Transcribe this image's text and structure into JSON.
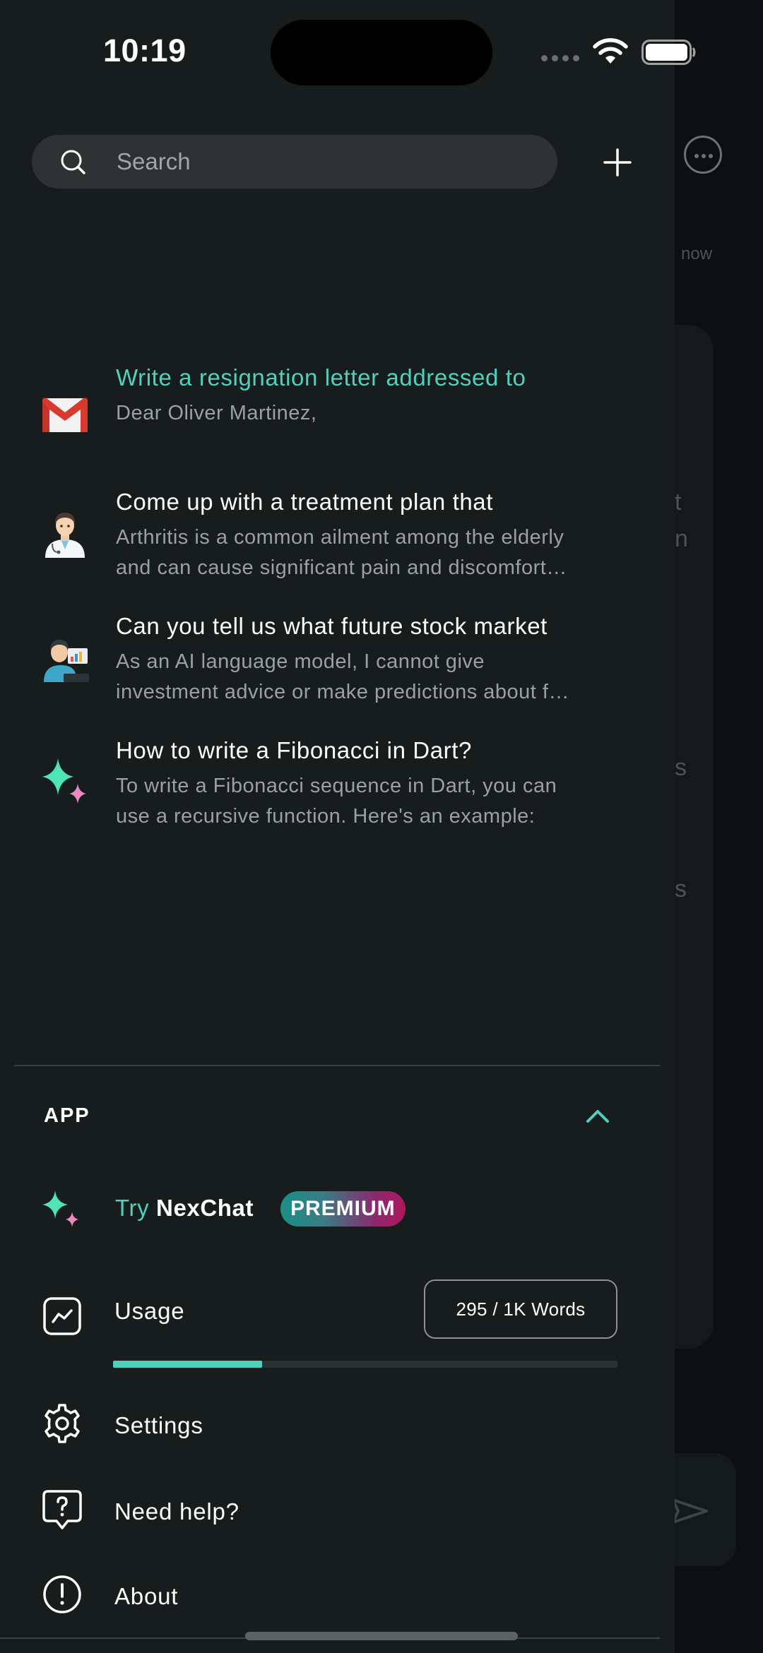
{
  "status_bar": {
    "time": "10:19"
  },
  "background_chat": {
    "timestamp": "now",
    "fragments": [
      "t",
      "n",
      "s",
      "s"
    ]
  },
  "search": {
    "placeholder": "Search"
  },
  "conversations": [
    {
      "icon": "gmail-icon",
      "title": "Write a resignation letter addressed to",
      "preview_lines": [
        "Dear Oliver Martinez,"
      ],
      "active": true
    },
    {
      "icon": "doctor-icon",
      "title": "Come up with a treatment plan that",
      "preview_lines": [
        "Arthritis is a common ailment among the elderly",
        "and can cause significant pain and discomfort…"
      ],
      "active": false
    },
    {
      "icon": "stock-analyst-icon",
      "title": "Can you tell us what future stock market",
      "preview_lines": [
        "As an AI language model, I cannot give",
        "investment advice or make predictions about f…"
      ],
      "active": false
    },
    {
      "icon": "sparkle-icon",
      "title": "How to write a Fibonacci in Dart?",
      "preview_lines": [
        "To write a Fibonacci sequence in Dart, you can",
        "use a recursive function. Here's an example:"
      ],
      "active": false
    }
  ],
  "app_section": {
    "label": "APP",
    "try_label": "Try",
    "brand": "NexChat",
    "badge": "PREMIUM",
    "usage_label": "Usage",
    "usage_words": "295 / 1K Words",
    "usage_fraction": 0.295,
    "settings_label": "Settings",
    "help_label": "Need help?",
    "about_label": "About"
  },
  "colors": {
    "accent": "#4fd1be",
    "drawer_bg": "#171c1d",
    "search_bg": "#2e3233"
  }
}
